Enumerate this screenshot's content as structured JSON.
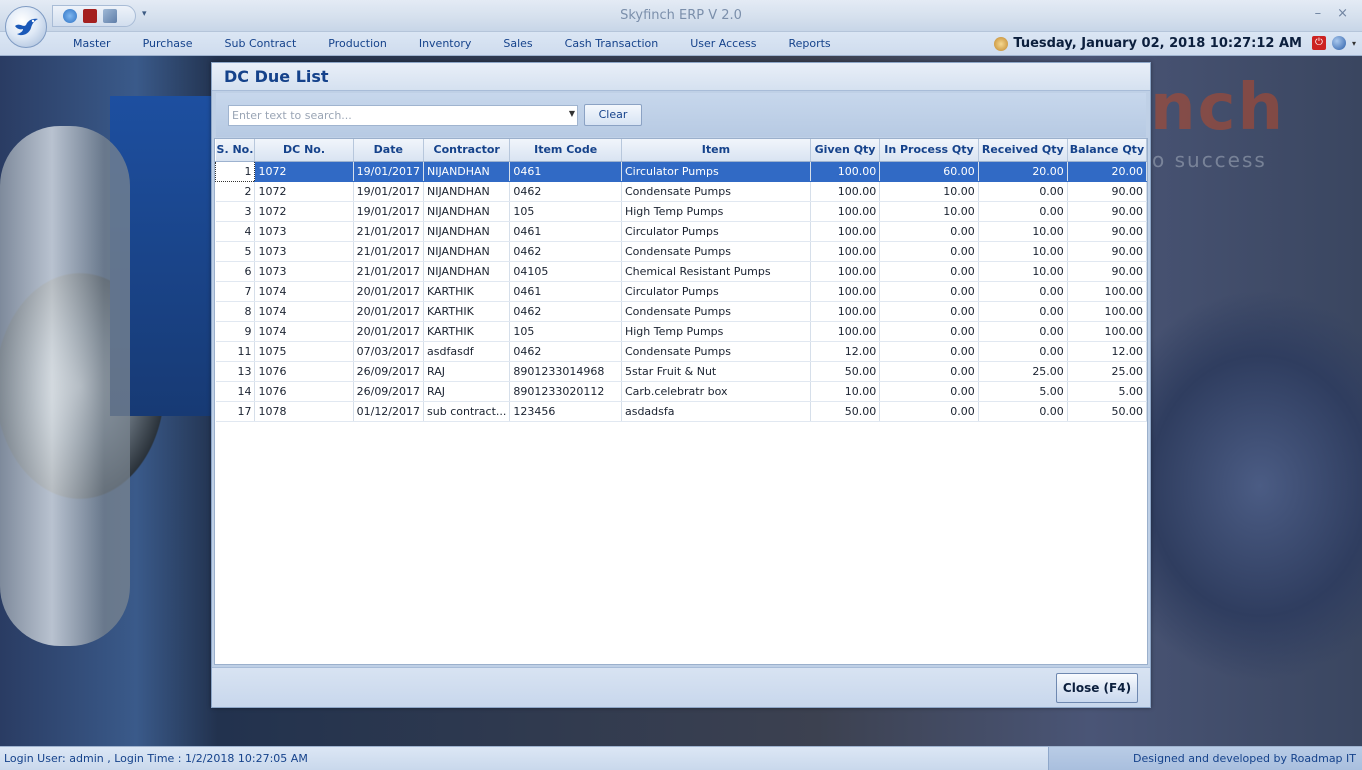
{
  "window": {
    "title": "Skyfinch  ERP V 2.0",
    "minimize_glyph": "–",
    "close_glyph": "×",
    "qat_more_glyph": "▾"
  },
  "menu": [
    "Master",
    "Purchase",
    "Sub Contract",
    "Production",
    "Inventory",
    "Sales",
    "Cash Transaction",
    "User Access",
    "Reports"
  ],
  "datetime": "Tuesday, January 02, 2018 10:27:12 AM",
  "background": {
    "logo_text": "nch",
    "tagline": "o success"
  },
  "dialog": {
    "title": "DC Due List",
    "search_placeholder": "Enter text to search...",
    "clear_label": "Clear",
    "close_label": "Close (F4)",
    "columns": [
      "S. No.",
      "DC No.",
      "Date",
      "Contractor",
      "Item Code",
      "Item",
      "Given Qty",
      "In Process Qty",
      "Received Qty",
      "Balance Qty"
    ],
    "rows": [
      [
        "1",
        "1072",
        "19/01/2017",
        "NIJANDHAN",
        "0461",
        "Circulator Pumps",
        "100.00",
        "60.00",
        "20.00",
        "20.00"
      ],
      [
        "2",
        "1072",
        "19/01/2017",
        "NIJANDHAN",
        "0462",
        "Condensate Pumps",
        "100.00",
        "10.00",
        "0.00",
        "90.00"
      ],
      [
        "3",
        "1072",
        "19/01/2017",
        "NIJANDHAN",
        "105",
        "High Temp Pumps",
        "100.00",
        "10.00",
        "0.00",
        "90.00"
      ],
      [
        "4",
        "1073",
        "21/01/2017",
        "NIJANDHAN",
        "0461",
        "Circulator Pumps",
        "100.00",
        "0.00",
        "10.00",
        "90.00"
      ],
      [
        "5",
        "1073",
        "21/01/2017",
        "NIJANDHAN",
        "0462",
        "Condensate Pumps",
        "100.00",
        "0.00",
        "10.00",
        "90.00"
      ],
      [
        "6",
        "1073",
        "21/01/2017",
        "NIJANDHAN",
        "04105",
        "Chemical Resistant Pumps",
        "100.00",
        "0.00",
        "10.00",
        "90.00"
      ],
      [
        "7",
        "1074",
        "20/01/2017",
        "KARTHIK",
        "0461",
        "Circulator Pumps",
        "100.00",
        "0.00",
        "0.00",
        "100.00"
      ],
      [
        "8",
        "1074",
        "20/01/2017",
        "KARTHIK",
        "0462",
        "Condensate Pumps",
        "100.00",
        "0.00",
        "0.00",
        "100.00"
      ],
      [
        "9",
        "1074",
        "20/01/2017",
        "KARTHIK",
        "105",
        "High Temp Pumps",
        "100.00",
        "0.00",
        "0.00",
        "100.00"
      ],
      [
        "11",
        "1075",
        "07/03/2017",
        "asdfasdf",
        "0462",
        "Condensate Pumps",
        "12.00",
        "0.00",
        "0.00",
        "12.00"
      ],
      [
        "13",
        "1076",
        "26/09/2017",
        "RAJ",
        "8901233014968",
        "5star Fruit & Nut",
        "50.00",
        "0.00",
        "25.00",
        "25.00"
      ],
      [
        "14",
        "1076",
        "26/09/2017",
        "RAJ",
        "8901233020112",
        "Carb.celebratr box",
        "10.00",
        "0.00",
        "5.00",
        "5.00"
      ],
      [
        "17",
        "1078",
        "01/12/2017",
        "sub contract...",
        "123456",
        "asdadsfa",
        "50.00",
        "0.00",
        "0.00",
        "50.00"
      ]
    ]
  },
  "status": {
    "left": "Login User: admin , Login Time : 1/2/2018 10:27:05 AM",
    "right": "Designed and developed by Roadmap IT Solutions,Puducherry"
  }
}
